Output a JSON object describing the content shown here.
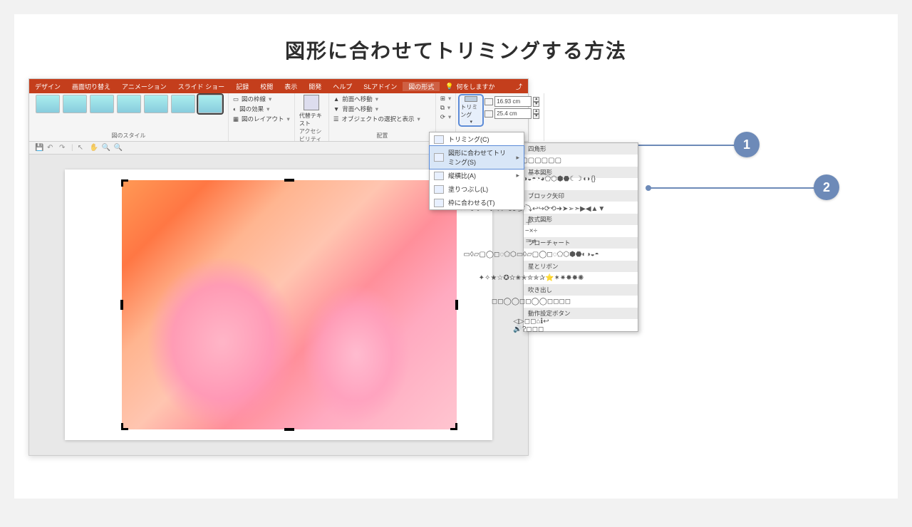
{
  "title": "図形に合わせてトリミングする方法",
  "callouts": {
    "c1": "1",
    "c2": "2"
  },
  "ribbon": {
    "tabs": [
      "デザイン",
      "画面切り替え",
      "アニメーション",
      "スライド ショー",
      "記録",
      "校閲",
      "表示",
      "開発",
      "ヘルプ",
      "SLアドイン"
    ],
    "active_tab": "図の形式",
    "tell_me": "何をしますか",
    "groups": {
      "styles_label": "図のスタイル",
      "accessibility_label": "アクセシビリティ",
      "arrange_label": "配置",
      "opts": {
        "border": "図の枠線",
        "effects": "図の効果",
        "layout": "図のレイアウト"
      },
      "alttext": "代替テキスト",
      "arrange": {
        "front": "前面へ移動",
        "back": "背面へ移動",
        "select": "オブジェクトの選択と表示"
      },
      "crop_label": "トリミング",
      "height": "16.93 cm",
      "width": "25.4 cm"
    }
  },
  "crop_menu": {
    "crop": "トリミング(C)",
    "crop_to_shape": "図形に合わせてトリミング(S)",
    "aspect": "縦横比(A)",
    "fill": "塗りつぶし(L)",
    "fit": "枠に合わせる(T)"
  },
  "shape_panel": {
    "cats": {
      "rect": "四角形",
      "basic": "基本図形",
      "block_arrows": "ブロック矢印",
      "equation": "数式図形",
      "flowchart": "フローチャート",
      "stars": "星とリボン",
      "callouts": "吹き出し",
      "action": "動作設定ボタン"
    },
    "rect_shapes": "▢▢▢▢▢▢▢▢▢",
    "basic_shapes": "○△▽◇□◯◻▱◊◌◐◑◒◓◔◕⬠⬡⬢⬣☾☽◖◗{}()〔〕",
    "arrow_shapes": "⇨⇦⇧⇩⇔⇕⇖⇗⇘⇙⤴⤵↩↪⟳⟲➜➤➢➣▶◀▲▼",
    "eq_shapes": "＋−×÷＝≠",
    "flow_shapes": "▭◊▱▢◯◻◌⬠⬡▭◊▱▢◯◻◌⬠⬡⬢⬣◐◑◒◓",
    "star_shapes": "✦✧★☆✪✫✬✭✮✯✰⭐✶✷✸✹✺",
    "callout_shapes": "◻◻◯◯◻◻◯◯◻◻◻◻",
    "action_shapes": "◁▷◻◻⌂ℹ↩🔊?◻◻◻"
  }
}
